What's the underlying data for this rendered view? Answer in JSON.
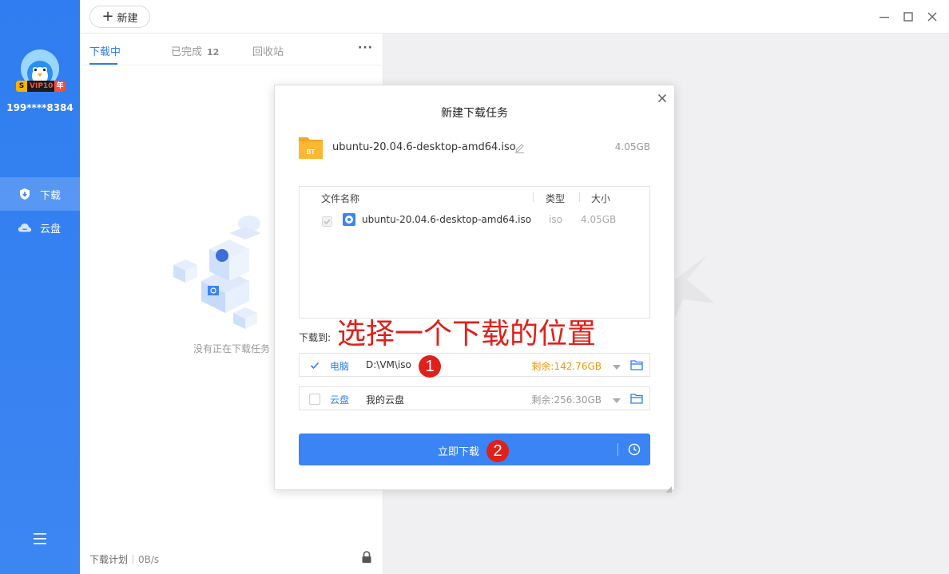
{
  "user": {
    "phone": "199****8384",
    "vip_s": "S",
    "vip_label": "VIP10",
    "vip_year": "年"
  },
  "sidebar": {
    "items": [
      {
        "label": "下载",
        "icon": "download-shield-icon"
      },
      {
        "label": "云盘",
        "icon": "cloud-icon"
      }
    ]
  },
  "topbar": {
    "new_label": "新建"
  },
  "tabs": [
    {
      "label": "下载中"
    },
    {
      "label": "已完成",
      "count": "12"
    },
    {
      "label": "回收站"
    }
  ],
  "empty_text": "没有正在下载任务",
  "footer": {
    "plan_label": "下载计划",
    "speed": "0B/s"
  },
  "dialog": {
    "title": "新建下载任务",
    "file_name": "ubuntu-20.04.6-desktop-amd64.iso",
    "file_size": "4.05GB",
    "file_badge": "BT",
    "table": {
      "headers": {
        "name": "文件名称",
        "type": "类型",
        "size": "大小"
      },
      "rows": [
        {
          "name": "ubuntu-20.04.6-desktop-amd64.iso",
          "type": "iso",
          "size": "4.05GB"
        }
      ]
    },
    "save_to_label": "下载到:",
    "destinations": [
      {
        "kind": "电脑",
        "path": "D:\\VM\\iso",
        "free": "剩余:142.76GB",
        "checked": true
      },
      {
        "kind": "云盘",
        "path": "我的云盘",
        "free": "剩余:256.30GB",
        "checked": false
      }
    ],
    "download_label": "立即下载"
  },
  "annotation": {
    "text": "选择一个下载的位置",
    "step1": "1",
    "step2": "2"
  },
  "colors": {
    "accent": "#2f7df0",
    "annotation": "#e0201a",
    "warn": "#f0960a"
  }
}
